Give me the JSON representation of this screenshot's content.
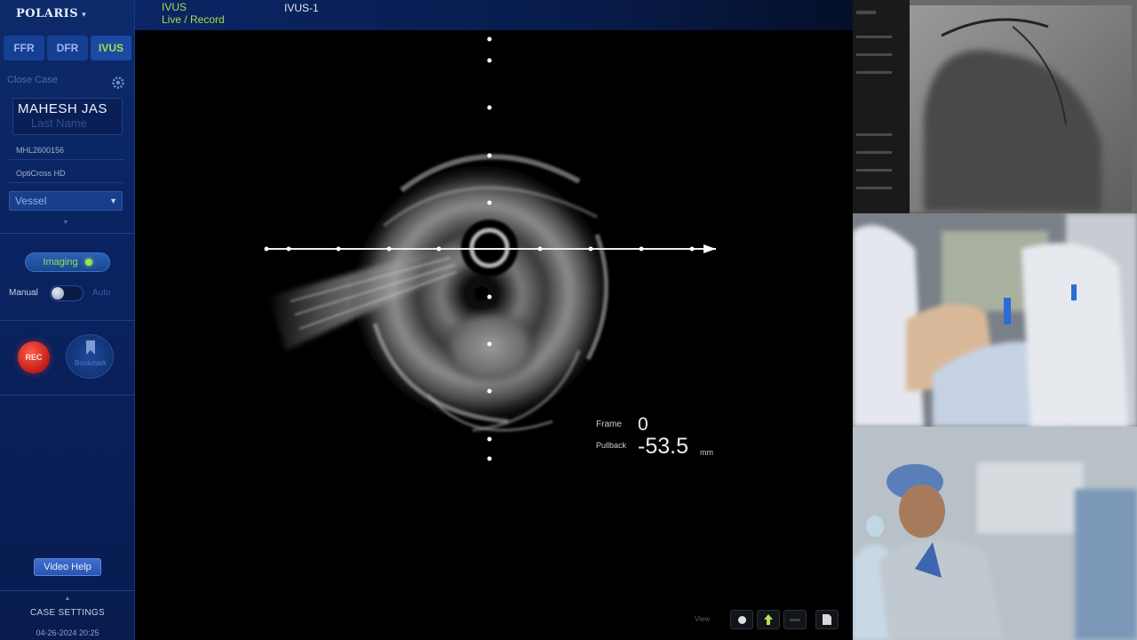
{
  "app": {
    "brand": "POLARIS",
    "brand_caret": "▾"
  },
  "sidebar": {
    "tabs": [
      {
        "label": "FFR",
        "active": false
      },
      {
        "label": "DFR",
        "active": false
      },
      {
        "label": "IVUS",
        "active": true
      }
    ],
    "close_case": "Close Case",
    "patient_first_name": "MAHESH JAS",
    "patient_last_name_placeholder": "Last Name",
    "patient_id": "MHL2600156",
    "catheter": "OptiCross HD",
    "vessel_select": "Vessel",
    "imaging_button": "Imaging",
    "manual_label": "Manual",
    "auto_label": "Auto",
    "rec_button": "REC",
    "bookmark_label": "Bookmark",
    "video_help": "Video Help",
    "case_settings": "CASE SETTINGS",
    "timestamp": "04-26-2024 20:25"
  },
  "header": {
    "mode": "IVUS",
    "status": "Live / Record",
    "run_name": "IVUS-1"
  },
  "ivus": {
    "frame_label": "Frame",
    "frame_value": "0",
    "pullback_label": "Pullback",
    "pullback_value": "-53.5",
    "pullback_unit": "mm",
    "controls_label": "View"
  },
  "colors": {
    "accent_green": "#9be34a",
    "sidebar_blue": "#0a2360",
    "rec_red": "#d8261c",
    "button_blue": "#2a55ae"
  }
}
